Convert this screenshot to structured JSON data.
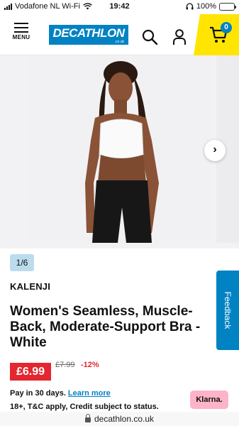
{
  "status_bar": {
    "carrier": "Vodafone NL Wi-Fi",
    "time": "19:42",
    "battery": "100%"
  },
  "header": {
    "menu_label": "MENU",
    "logo_text": "DECATHLON",
    "logo_sub": ".co.uk",
    "cart_count": "0",
    "accent_color": "#0082c3",
    "cart_bg": "#ffe500"
  },
  "gallery": {
    "counter": "1/6",
    "next_arrow": "›"
  },
  "product": {
    "brand": "KALENJI",
    "title": "Women's Seamless, Muscle-Back, Moderate-Support Bra - White",
    "price": "£6.99",
    "old_price": "£7.99",
    "discount": "-12%",
    "pay_text": "Pay in 30 days.",
    "learn_more": "Learn more",
    "terms": "18+, T&C apply, Credit subject to status.",
    "klarna_label": "Klarna."
  },
  "feedback_label": "Feedback",
  "url": "decathlon.co.uk"
}
